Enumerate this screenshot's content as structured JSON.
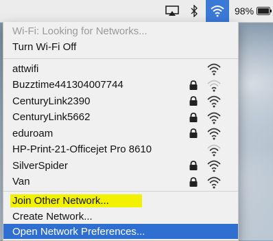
{
  "menubar": {
    "airplay_icon": "airplay-icon",
    "bluetooth_icon": "bluetooth-icon",
    "wifi_icon": "wifi-icon",
    "battery_percent": "98%",
    "battery_icon": "battery-icon",
    "accent_color": "#3a79d6"
  },
  "menu": {
    "status": "Wi-Fi: Looking for Networks...",
    "toggle": "Turn Wi-Fi Off",
    "networks": [
      {
        "name": "attwifi",
        "locked": false,
        "signal": "strong"
      },
      {
        "name": "Buzztime441304007744",
        "locked": true,
        "signal": "weak"
      },
      {
        "name": "CenturyLink2390",
        "locked": true,
        "signal": "strong"
      },
      {
        "name": "CenturyLink5662",
        "locked": true,
        "signal": "strong"
      },
      {
        "name": "eduroam",
        "locked": true,
        "signal": "strong"
      },
      {
        "name": "HP-Print-21-Officejet Pro 8610",
        "locked": false,
        "signal": "medium"
      },
      {
        "name": "SilverSpider",
        "locked": true,
        "signal": "strong"
      },
      {
        "name": "Van",
        "locked": true,
        "signal": "strong"
      }
    ],
    "join_other": "Join Other Network...",
    "create_network": "Create Network...",
    "open_prefs": "Open Network Preferences...",
    "selection_color": "#2f6fd2",
    "join_highlight_color": "#f2f200"
  }
}
